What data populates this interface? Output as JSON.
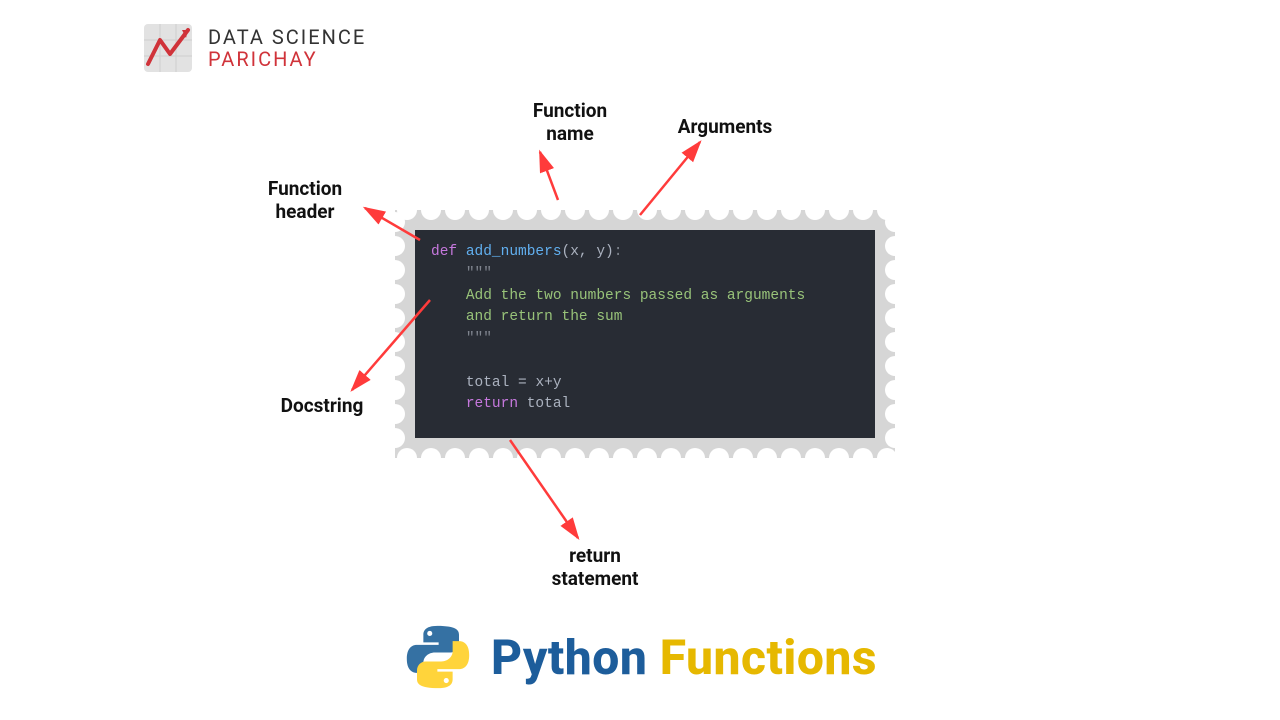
{
  "logo": {
    "line1": "DATA SCIENCE",
    "line2": "PARICHAY"
  },
  "labels": {
    "function_name": "Function\nname",
    "arguments": "Arguments",
    "function_header": "Function\nheader",
    "docstring": "Docstring",
    "return_statement": "return\nstatement"
  },
  "code": {
    "def": "def",
    "fn_name": "add_numbers",
    "params": "(x, y)",
    "colon": ":",
    "triple_quote": "\"\"\"",
    "doc_line1": "Add the two numbers passed as arguments",
    "doc_line2": "and return the sum",
    "assign_left": "total",
    "assign_eq": " = ",
    "assign_right": "x+y",
    "return_kw": "return",
    "return_val": " total"
  },
  "title": {
    "word1": "Python",
    "word2": "Functions"
  },
  "colors": {
    "arrow": "#ff3b3b",
    "code_bg": "#282c34",
    "stamp_bg": "#d6d6d6",
    "brand_red": "#d0333a",
    "title_blue": "#1d5d9b",
    "title_yellow": "#e6b800"
  }
}
